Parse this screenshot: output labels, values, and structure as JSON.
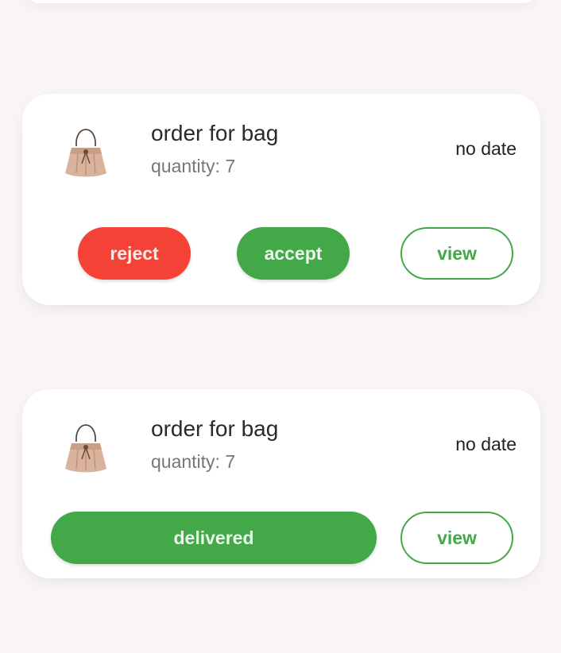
{
  "orders": [
    {
      "title": "order for bag",
      "quantity": "quantity: 7",
      "date": "no date",
      "reject_label": "reject",
      "accept_label": "accept",
      "view_label": "view",
      "product_icon": "handbag-icon"
    },
    {
      "title": "order for bag",
      "quantity": "quantity: 7",
      "date": "no date",
      "delivered_label": "delivered",
      "view_label": "view",
      "product_icon": "handbag-icon"
    }
  ],
  "colors": {
    "reject": "#f44336",
    "accept": "#43a847",
    "background": "#f9f5f9",
    "card": "#ffffff"
  }
}
